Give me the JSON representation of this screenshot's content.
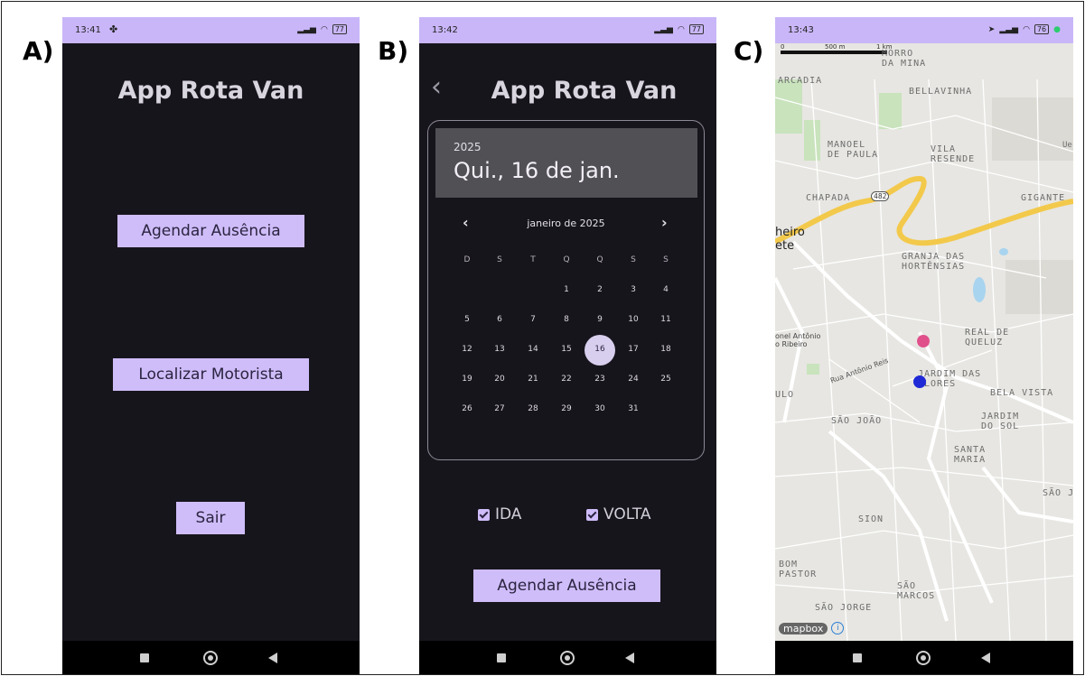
{
  "labels": {
    "a": "A)",
    "b": "B)",
    "c": "C)"
  },
  "phone_a": {
    "time": "13:41",
    "battery": "77",
    "title": "App Rota Van",
    "buttons": {
      "schedule": "Agendar Ausência",
      "locate": "Localizar Motorista",
      "logout": "Sair"
    }
  },
  "phone_b": {
    "time": "13:42",
    "battery": "77",
    "title": "App Rota Van",
    "calendar": {
      "year": "2025",
      "selected_label": "Qui., 16 de jan.",
      "month_label": "janeiro de 2025",
      "weekdays": [
        "D",
        "S",
        "T",
        "Q",
        "Q",
        "S",
        "S"
      ],
      "first_weekday_index": 3,
      "days_in_month": 31,
      "selected_day": 16
    },
    "options": {
      "ida": "IDA",
      "volta": "VOLTA"
    },
    "schedule_button": "Agendar Ausência"
  },
  "phone_c": {
    "time": "13:43",
    "battery": "76",
    "scale_labels": {
      "zero": "0",
      "m500": "500 m",
      "km1": "1 km"
    },
    "attribution": "mapbox",
    "map_labels": {
      "morro": "MORRO\nDA MINA",
      "arcadia": "ARCADIA",
      "bellavinha": "BELLAVINHA",
      "manoel": "MANOEL\nDE PAULA",
      "vila": "VILA\nRESENDE",
      "chapada": "CHAPADA",
      "road": "482",
      "gigante": "GIGANTE",
      "heiro": "heiro\nete",
      "granja": "GRANJA DAS\nHORTÊNSIAS",
      "onel": "onel Antônio\no Ribeiro",
      "real": "REAL DE\nQUELUZ",
      "rua": "Rua Antônio Reis",
      "jardim_flores": "JARDIM DAS\nFLORES",
      "ulo": "ULO",
      "bela": "BELA VISTA",
      "sao_joao": "SÃO JOÃO",
      "jardim_sol": "JARDIM\nDO SOL",
      "santa": "SANTA\nMARIA",
      "sao_edge": "SÃO J",
      "sion": "SION",
      "bom": "BOM\nPASTOR",
      "sao_marcos": "SÃO\nMARCOS",
      "sao_jorge": "SÃO JORGE",
      "ue": "Ue"
    },
    "markers": {
      "destination_color": "#e0518c",
      "driver_color": "#1f2ad6"
    }
  },
  "colors": {
    "accent": "#cfbdfa",
    "status_bar": "#c9b6f8",
    "background": "#17151c"
  }
}
